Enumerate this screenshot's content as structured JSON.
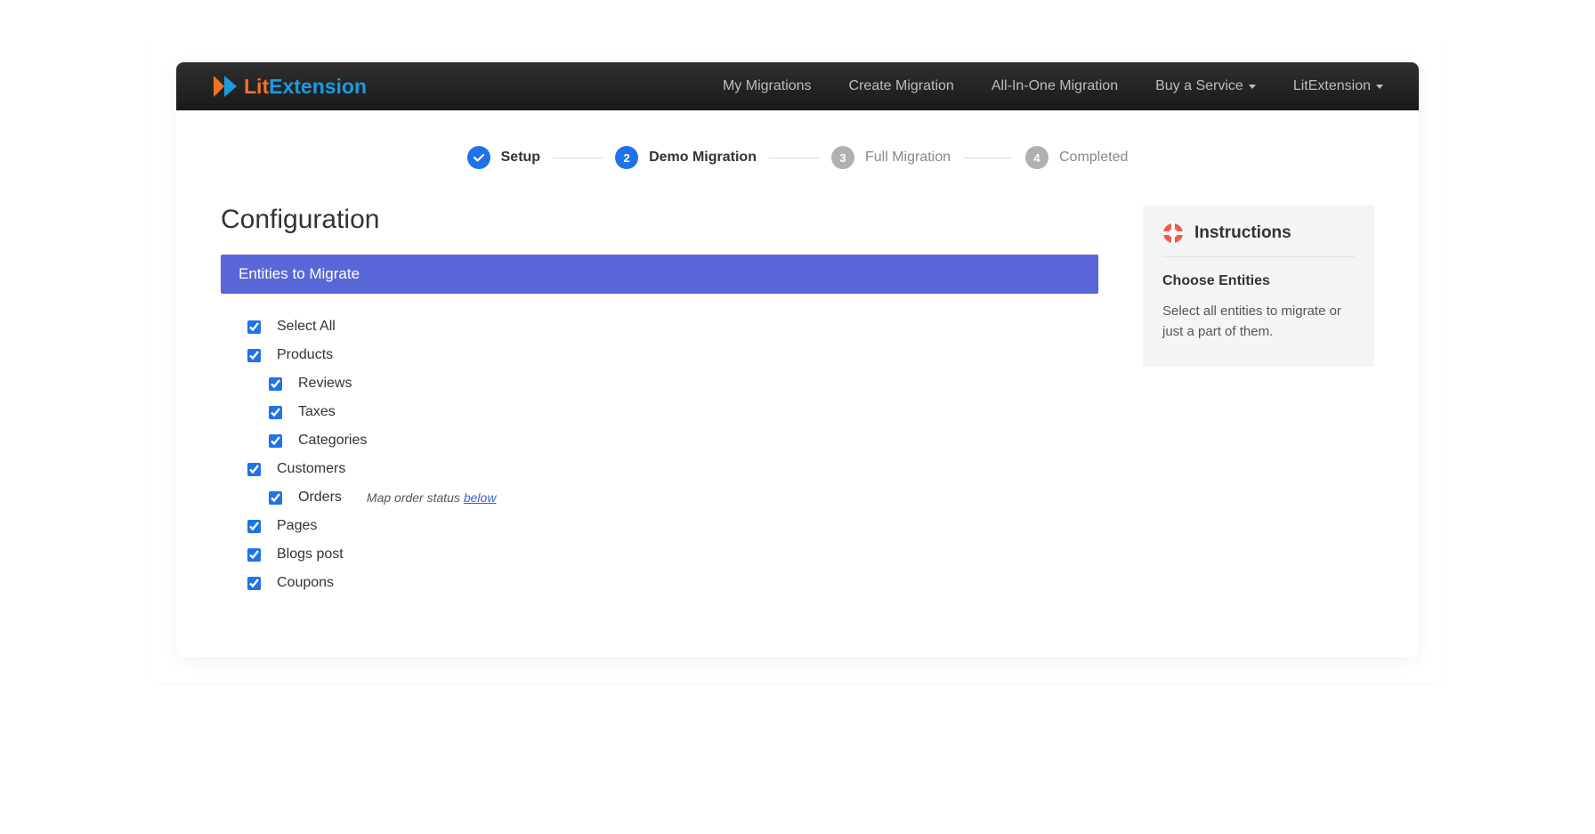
{
  "brand": {
    "lit": "Lit",
    "extension": "Extension"
  },
  "nav": {
    "my_migrations": "My Migrations",
    "create_migration": "Create Migration",
    "all_in_one": "All-In-One Migration",
    "buy_service": "Buy a Service",
    "litextension": "LitExtension"
  },
  "stepper": {
    "setup": "Setup",
    "demo": "Demo Migration",
    "full": "Full Migration",
    "completed": "Completed",
    "num2": "2",
    "num3": "3",
    "num4": "4"
  },
  "page": {
    "title": "Configuration",
    "section_header": "Entities to Migrate"
  },
  "entities": {
    "select_all": "Select All",
    "products": "Products",
    "reviews": "Reviews",
    "taxes": "Taxes",
    "categories": "Categories",
    "customers": "Customers",
    "orders": "Orders",
    "order_note_prefix": "Map order status ",
    "order_note_link": "below",
    "pages": "Pages",
    "blogs": "Blogs post",
    "coupons": "Coupons"
  },
  "instructions": {
    "title": "Instructions",
    "subtitle": "Choose Entities",
    "text": "Select all entities to migrate or just a part of them."
  }
}
